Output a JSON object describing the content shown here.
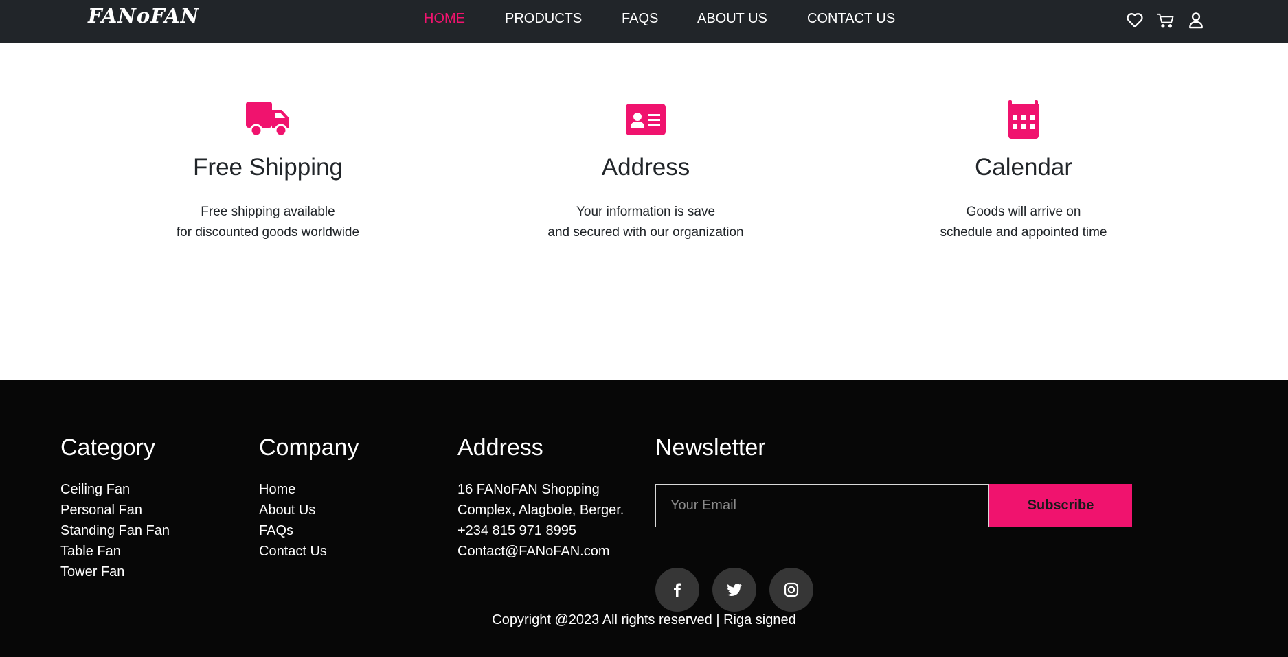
{
  "header": {
    "logo": "FANoFAN",
    "nav": [
      {
        "label": "HOME",
        "active": true
      },
      {
        "label": "PRODUCTS",
        "active": false
      },
      {
        "label": "FAQS",
        "active": false
      },
      {
        "label": "ABOUT US",
        "active": false
      },
      {
        "label": "CONTACT US",
        "active": false
      }
    ],
    "icons": [
      "heart-icon",
      "cart-icon",
      "user-icon"
    ]
  },
  "features": [
    {
      "icon": "truck-icon",
      "title": "Free Shipping",
      "line1": "Free shipping available",
      "line2": "for discounted goods worldwide"
    },
    {
      "icon": "id-card-icon",
      "title": "Address",
      "line1": "Your information is save",
      "line2": "and secured with our organization"
    },
    {
      "icon": "calendar-icon",
      "title": "Calendar",
      "line1": "Goods will arrive on",
      "line2": "schedule and appointed time"
    }
  ],
  "footer": {
    "category": {
      "title": "Category",
      "items": [
        "Ceiling Fan",
        "Personal Fan",
        "Standing Fan Fan",
        "Table Fan",
        "Tower Fan"
      ]
    },
    "company": {
      "title": "Company",
      "items": [
        "Home",
        "About Us",
        "FAQs",
        "Contact Us"
      ]
    },
    "address": {
      "title": "Address",
      "lines": [
        "16 FANoFAN Shopping",
        "Complex, Alagbole, Berger.",
        "+234 815 971 8995",
        "Contact@FANoFAN.com"
      ]
    },
    "newsletter": {
      "title": "Newsletter",
      "placeholder": "Your Email",
      "button": "Subscribe"
    },
    "socials": [
      "facebook-icon",
      "twitter-icon",
      "instagram-icon"
    ],
    "copyright": "Copyright @2023 All rights reserved | Riga signed"
  },
  "colors": {
    "accent": "#f0136e",
    "header_bg": "#212529",
    "footer_bg": "#070707",
    "social_bg": "#363636"
  }
}
